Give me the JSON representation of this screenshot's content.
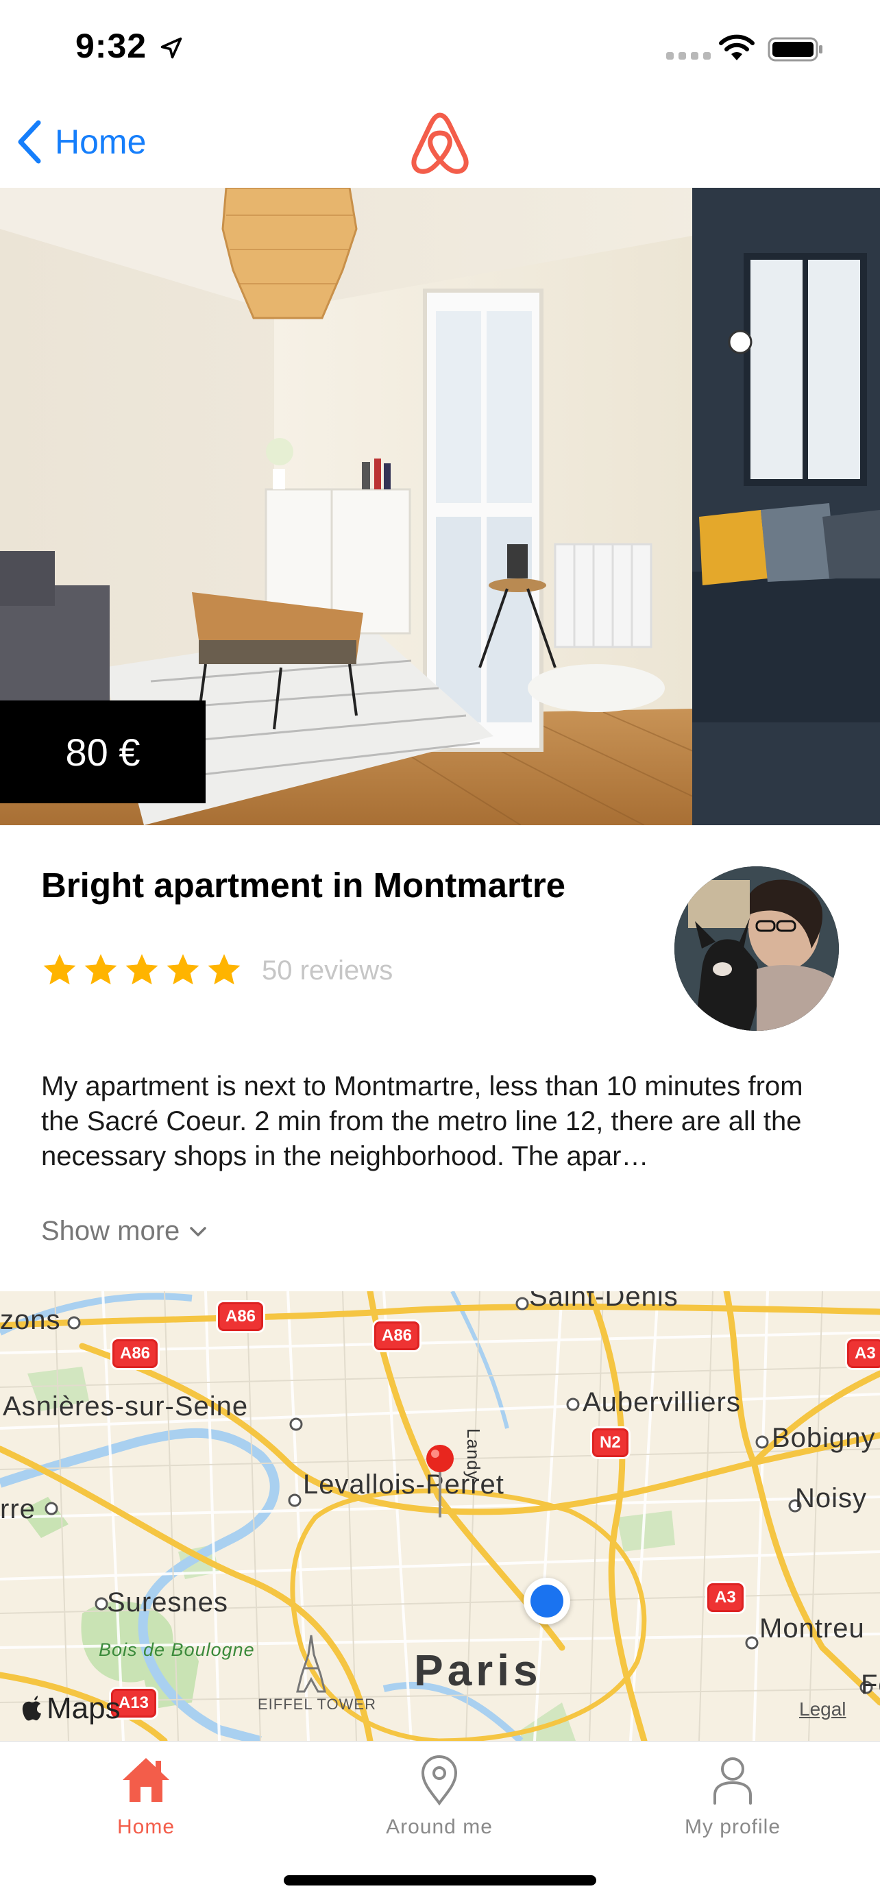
{
  "status_bar": {
    "time": "9:32"
  },
  "nav": {
    "back_label": "Home"
  },
  "listing": {
    "price": "80 €",
    "title": "Bright apartment in Montmartre",
    "rating": 5,
    "reviews": "50 reviews",
    "description": "My apartment is next to Montmartre, less than 10 minutes from the Sacré Coeur. 2 min from the metro line 12, there are all the necessary shops in the neighborhood. The apar…",
    "show_more": "Show more"
  },
  "map": {
    "labels": {
      "saint_denis": "Saint-Denis",
      "zons": "zons",
      "asnieres": "Asnières-sur-Seine",
      "aubervilliers": "Aubervilliers",
      "bobigny": "Bobigny",
      "landy": "Landy",
      "levallois": "Levallois-Perret",
      "noisy": "Noisy",
      "rre": "rre",
      "suresnes": "Suresnes",
      "montreuil": "Montreu",
      "bois": "Bois de Boulogne",
      "paris": "Paris",
      "eiffel": "EIFFEL TOWER",
      "fo": "Fo"
    },
    "roads": {
      "a86_1": "A86",
      "a86_2": "A86",
      "a86_3": "A86",
      "a3_1": "A3",
      "a3_2": "A3",
      "n2": "N2",
      "a13": "A13"
    },
    "maps_logo": "Maps",
    "legal": "Legal"
  },
  "tabs": [
    {
      "label": "Home",
      "icon": "house-icon",
      "active": true
    },
    {
      "label": "Around me",
      "icon": "location-pin-icon",
      "active": false
    },
    {
      "label": "My profile",
      "icon": "person-icon",
      "active": false
    }
  ],
  "colors": {
    "accent": "#f35d4a",
    "ios_blue": "#157efb",
    "star": "#ffb400",
    "user_dot": "#1a73f0"
  }
}
